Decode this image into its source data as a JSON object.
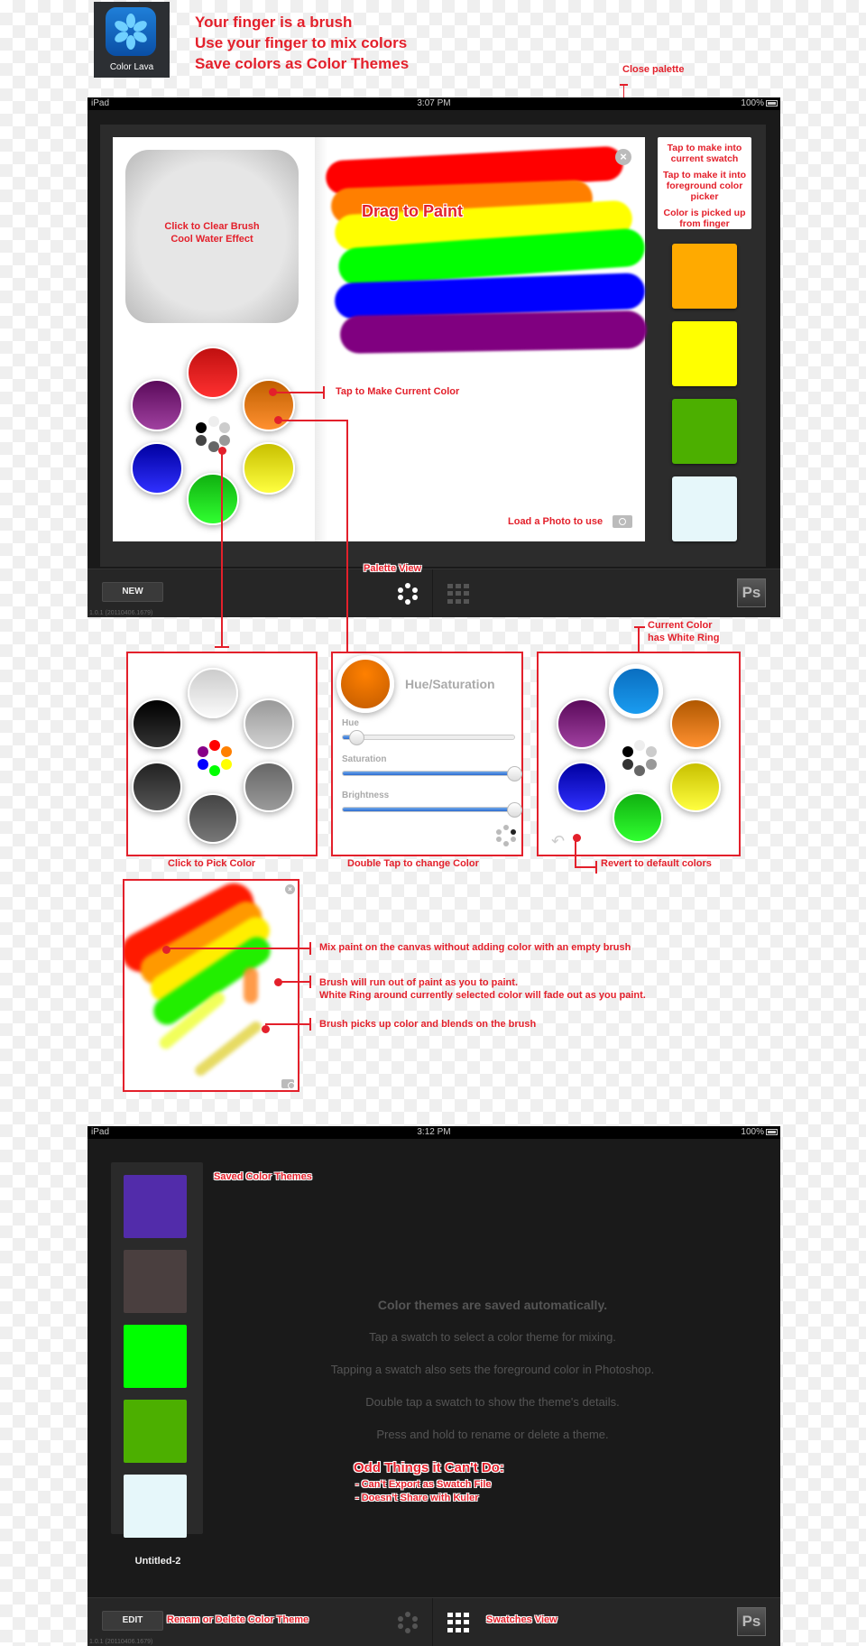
{
  "header": {
    "app_name": "Color Lava",
    "lines": [
      "Your finger is a brush",
      "Use your finger to mix colors",
      "Save colors as Color Themes"
    ]
  },
  "palette_screen": {
    "status": {
      "device": "iPad",
      "time": "3:07 PM",
      "battery": "100%"
    },
    "clear_brush": [
      "Click to Clear Brush",
      "Cool Water Effect"
    ],
    "canvas_label": "Drag to Paint",
    "load_photo": "Load a Photo to use",
    "close_icon": "×",
    "notes": [
      "Tap to make into current swatch",
      "Tap to make it into foreground color picker",
      "Color is picked up from finger"
    ],
    "current_swatches": [
      "#ffaa00",
      "#ffff00",
      "#4caf00",
      "#e6f7fa"
    ],
    "strokes": [
      "#ff0000",
      "#ff7f00",
      "#ffff00",
      "#00ff00",
      "#0000ff",
      "#800080"
    ],
    "palette_colors": {
      "top": "#ff1a1a",
      "top_right": "#ff8000",
      "bottom_right": "#ffee00",
      "bottom": "#11dd11",
      "bottom_left": "#1111ee",
      "top_left": "#8a1a8a"
    },
    "toolbar": {
      "new_label": "NEW",
      "version": "1.0.1 (20110406.1679)",
      "ps_label": "Ps"
    }
  },
  "annotations": {
    "close_palette": "Close palette",
    "tap_current": "Tap to Make Current Color",
    "palette_view": "Palette View",
    "current_ring": [
      "Current Color",
      "has White Ring"
    ],
    "pick_color": "Click to Pick Color",
    "double_tap": "Double Tap to change Color",
    "revert": "Revert to default colors",
    "mix_paint": "Mix paint on the canvas without adding color with an empty brush",
    "run_out": [
      "Brush will run out of paint as you to paint.",
      "White Ring around currently selected color will fade out as you paint."
    ],
    "pick_blend": "Brush picks up color and blends on the brush"
  },
  "hue_panel": {
    "title": "Hue/Saturation",
    "color": "#ff8000",
    "sliders": [
      {
        "label": "Hue",
        "value": 0.08
      },
      {
        "label": "Saturation",
        "value": 1.0
      },
      {
        "label": "Brightness",
        "value": 1.0
      }
    ]
  },
  "grayscale_picker": [
    "#f0f0f0",
    "#bbbbbb",
    "#909090",
    "#666666",
    "#333333",
    "#000000"
  ],
  "selected_palette": {
    "current": "#1a9cf0"
  },
  "themes_screen": {
    "status": {
      "device": "iPad",
      "time": "3:12 PM",
      "battery": "100%"
    },
    "saved_label": "Saved Color Themes",
    "theme_colors": [
      "#522caa",
      "#4a3f3f",
      "#00ff00",
      "#4caf00",
      "#e6f7fa"
    ],
    "theme_name": "Untitled-2",
    "info_title": "Color themes are saved automatically.",
    "info_lines": [
      "Tap a swatch to select a color theme for mixing.",
      "Tapping a swatch also sets the foreground color in Photoshop.",
      "Double tap a swatch to show the theme's details.",
      "Press and hold to rename or delete a theme."
    ],
    "cant_do_title": "Odd Things it Can't Do:",
    "cant_do": [
      "- Can't Export as Swatch File",
      "- Doesn't Share with Kuler"
    ],
    "toolbar": {
      "edit_label": "EDIT",
      "edit_note": "Renam or Delete Color Theme",
      "swatches_view": "Swatches View",
      "version": "1.0.1 (20110406.1679)",
      "ps_label": "Ps"
    }
  }
}
